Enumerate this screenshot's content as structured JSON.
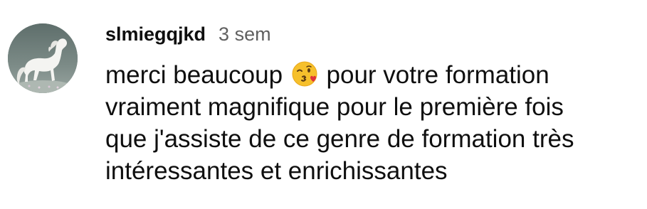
{
  "comment": {
    "username": "slmiegqjkd",
    "timestamp": "3 sem",
    "avatar_icon": "white-horse-avatar",
    "emoji_icon": "face-blowing-a-kiss-emoji",
    "text_lines": [
      {
        "before": "merci beaucoup",
        "after": "pour votre formation"
      },
      "vraiment magnifique pour le première fois",
      "que j'assiste de ce genre de formation très",
      "intéressantes et enrichissantes"
    ]
  },
  "colors": {
    "username": "#0f0f0f",
    "timestamp": "#606060",
    "body_text": "#0f0f0f",
    "background": "#ffffff"
  }
}
